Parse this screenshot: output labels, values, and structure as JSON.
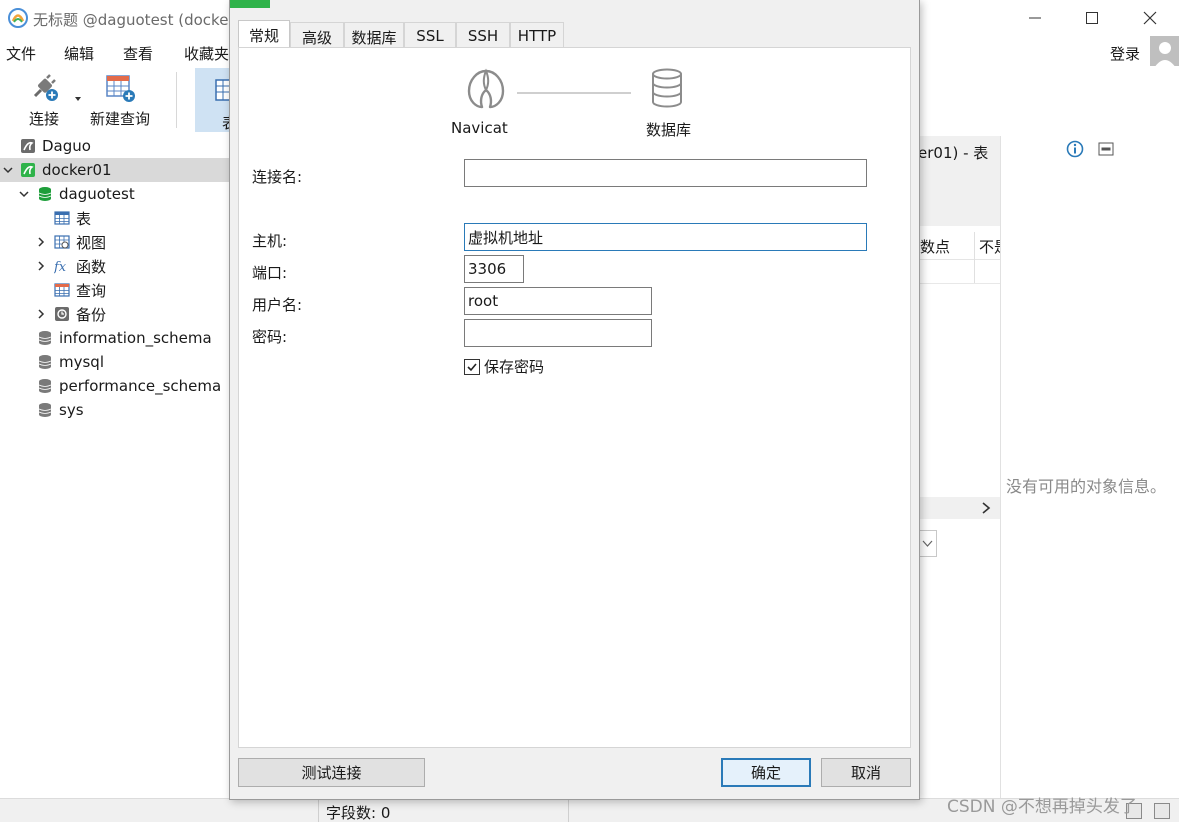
{
  "window": {
    "title": "无标题 @daguotest (docker",
    "colors": {
      "accent": "#2a7ab8",
      "connection_green": "#2fb34a",
      "db_green": "#1e9e3a"
    }
  },
  "menu": [
    "文件",
    "编辑",
    "查看",
    "收藏夹"
  ],
  "user": {
    "login": "登录"
  },
  "toolbar": {
    "connect": "连接",
    "new_query": "新建查询",
    "table_partial": "表"
  },
  "tree": {
    "connections": [
      {
        "label": "Daguo",
        "icon": "mysql-connection-icon"
      },
      {
        "label": "docker01",
        "icon": "mysql-connection-open-icon"
      }
    ],
    "database": "daguotest",
    "objects": [
      {
        "label": "表",
        "icon": "table-icon"
      },
      {
        "label": "视图",
        "icon": "view-icon"
      },
      {
        "label": "函数",
        "icon": "function-icon"
      },
      {
        "label": "查询",
        "icon": "query-icon"
      },
      {
        "label": "备份",
        "icon": "backup-icon"
      }
    ],
    "other_databases": [
      "information_schema",
      "mysql",
      "performance_schema",
      "sys"
    ]
  },
  "background": {
    "tab_title": "er01) - 表",
    "col1": "数点",
    "col2": "不是",
    "no_info": "没有可用的对象信息。",
    "field_count": "字段数: 0",
    "watermark": "CSDN @不想再掉头发了"
  },
  "dialog": {
    "tabs": [
      "常规",
      "高级",
      "数据库",
      "SSL",
      "SSH",
      "HTTP"
    ],
    "active_tab": "常规",
    "hero": {
      "left_label": "Navicat",
      "right_label": "数据库"
    },
    "fields": {
      "connection_name": {
        "label": "连接名:",
        "value": ""
      },
      "host": {
        "label": "主机:",
        "value": "虚拟机地址"
      },
      "port": {
        "label": "端口:",
        "value": "3306"
      },
      "username": {
        "label": "用户名:",
        "value": "root"
      },
      "password": {
        "label": "密码:",
        "value": ""
      }
    },
    "save_password": {
      "label": "保存密码",
      "checked": true
    },
    "buttons": {
      "test": "测试连接",
      "ok": "确定",
      "cancel": "取消"
    }
  }
}
